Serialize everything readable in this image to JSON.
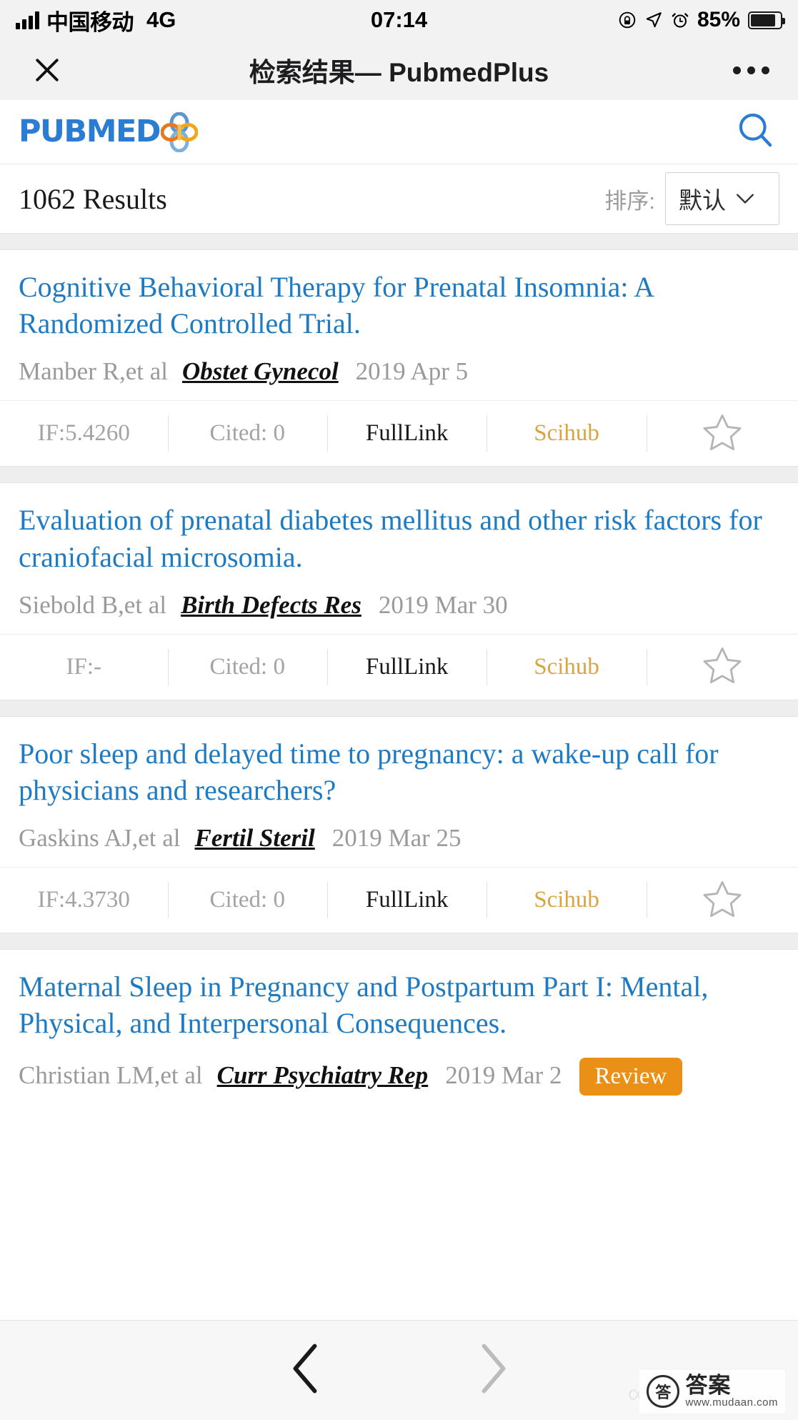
{
  "status_bar": {
    "carrier": "中国移动",
    "network": "4G",
    "time": "07:14",
    "battery_percent": "85%",
    "icons": [
      "signal-bars-icon",
      "rotation-lock-icon",
      "location-arrow-icon",
      "alarm-clock-icon",
      "battery-icon"
    ]
  },
  "title_bar": {
    "close_label": "✕",
    "title": "检索结果— PubmedPlus",
    "more_label": "•••"
  },
  "pubmed_header": {
    "logo_text": "PUBMED",
    "logo_mark": "pubmed-clover-icon",
    "search_icon": "search-icon"
  },
  "results_bar": {
    "count_text": "1062 Results",
    "sort_label": "排序:",
    "sort_value": "默认",
    "sort_chevron": "chevron-down-icon"
  },
  "actions": {
    "cited_prefix": "Cited: ",
    "fulllink_label": "FullLink",
    "scihub_label": "Scihub",
    "favorite_icon": "star-outline-icon"
  },
  "articles": [
    {
      "title": "Cognitive Behavioral Therapy for Prenatal Insomnia: A Randomized Controlled Trial.",
      "authors": "Manber R,et al",
      "journal": "Obstet Gynecol",
      "date": "2019 Apr 5",
      "badge": "",
      "impact_factor": "IF:5.4260",
      "cited": "Cited: 0",
      "fulllink": "FullLink",
      "scihub": "Scihub"
    },
    {
      "title": "Evaluation of prenatal diabetes mellitus and other risk factors for craniofacial microsomia.",
      "authors": "Siebold B,et al",
      "journal": "Birth Defects Res",
      "date": "2019 Mar 30",
      "badge": "",
      "impact_factor": "IF:-",
      "cited": "Cited: 0",
      "fulllink": "FullLink",
      "scihub": "Scihub"
    },
    {
      "title": "Poor sleep and delayed time to pregnancy: a wake-up call for physicians and researchers?",
      "authors": "Gaskins AJ,et al",
      "journal": "Fertil Steril",
      "date": "2019 Mar 25",
      "badge": "",
      "impact_factor": "IF:4.3730",
      "cited": "Cited: 0",
      "fulllink": "FullLink",
      "scihub": "Scihub"
    },
    {
      "title": "Maternal Sleep in Pregnancy and Postpartum Part I: Mental, Physical, and Interpersonal Consequences.",
      "authors": "Christian LM,et al",
      "journal": "Curr Psychiatry Rep",
      "date": "2019 Mar 2",
      "badge": "Review",
      "impact_factor": "",
      "cited": "",
      "fulllink": "",
      "scihub": ""
    }
  ],
  "bottom_nav": {
    "back_icon": "chevron-left-icon",
    "forward_icon": "chevron-right-icon"
  },
  "watermark": {
    "mark": "答",
    "name": "答案",
    "url": "www.mudaan.com"
  },
  "colors": {
    "title_link": "#1f7bc1",
    "scihub": "#d9a441",
    "badge": "#eb9016",
    "logo_blue": "#2b7cd3",
    "muted": "#9a9a9a"
  }
}
